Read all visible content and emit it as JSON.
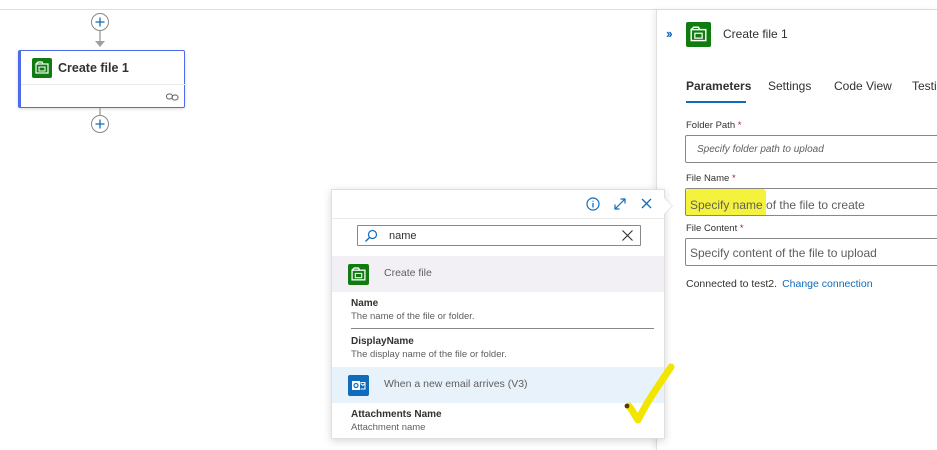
{
  "canvas": {
    "action_card": {
      "title": "Create file 1"
    }
  },
  "panel": {
    "title": "Create file 1",
    "tabs": [
      {
        "label": "Parameters",
        "active": true
      },
      {
        "label": "Settings",
        "active": false
      },
      {
        "label": "Code View",
        "active": false
      },
      {
        "label": "Testi",
        "active": false
      }
    ],
    "fields": {
      "folder_path": {
        "label": "Folder Path",
        "required": "*",
        "placeholder": "Specify folder path to upload"
      },
      "file_name": {
        "label": "File Name",
        "required": "*",
        "placeholder_highlighted": "Specify name",
        "placeholder_rest": " of the file to create"
      },
      "file_content": {
        "label": "File Content",
        "required": "*",
        "placeholder": "Specify content of the file to upload"
      }
    },
    "connection": {
      "text": "Connected to test2.",
      "link": "Change connection"
    }
  },
  "popup": {
    "search": {
      "value": "name"
    },
    "groups": [
      {
        "label": "Create file",
        "icon": "sharepoint-icon",
        "color": "#107c10",
        "tokens": [
          {
            "name": "Name",
            "description": "The name of the file or folder."
          },
          {
            "name": "DisplayName",
            "description": "The display name of the file or folder."
          }
        ]
      },
      {
        "label": "When a new email arrives (V3)",
        "icon": "outlook-icon",
        "color": "#0f6cbd",
        "tokens": [
          {
            "name": "Attachments Name",
            "description": "Attachment name"
          }
        ]
      }
    ]
  },
  "colors": {
    "accent": "#0f6cbd",
    "sharepoint_green": "#107c10",
    "highlight": "#f5f23e",
    "selected_group_bg": "#f3f0f5",
    "outlook_group_bg": "#e8f2fb"
  }
}
